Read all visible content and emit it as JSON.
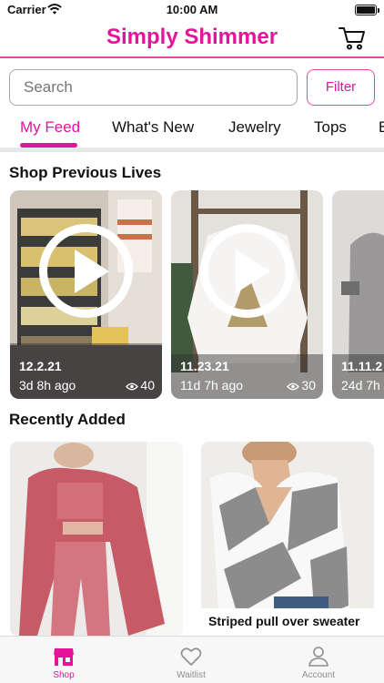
{
  "status_bar": {
    "carrier": "Carrier",
    "time": "10:00 AM"
  },
  "header": {
    "title": "Simply Shimmer",
    "cart_icon": "cart-icon"
  },
  "search": {
    "placeholder": "Search",
    "filter_label": "Filter"
  },
  "tabs": [
    {
      "label": "My Feed",
      "active": true
    },
    {
      "label": "What's New"
    },
    {
      "label": "Jewelry"
    },
    {
      "label": "Tops"
    },
    {
      "label": "B"
    }
  ],
  "previous_lives": {
    "title": "Shop Previous Lives",
    "items": [
      {
        "date": "12.2.21",
        "ago": "3d 8h ago",
        "views": "40"
      },
      {
        "date": "11.23.21",
        "ago": "11d 7h ago",
        "views": "30"
      },
      {
        "date": "11.11.2",
        "ago": "24d 7h",
        "views": ""
      }
    ]
  },
  "recently_added": {
    "title": "Recently Added",
    "items": [
      {
        "name": ""
      },
      {
        "name": "Striped pull over sweater"
      }
    ]
  },
  "tabbar": [
    {
      "label": "Shop",
      "icon": "shop-icon",
      "active": true
    },
    {
      "label": "Waitlist",
      "icon": "heart-icon"
    },
    {
      "label": "Account",
      "icon": "person-icon"
    }
  ],
  "colors": {
    "brand": "#e5139a",
    "accent_border": "#e9489f"
  }
}
